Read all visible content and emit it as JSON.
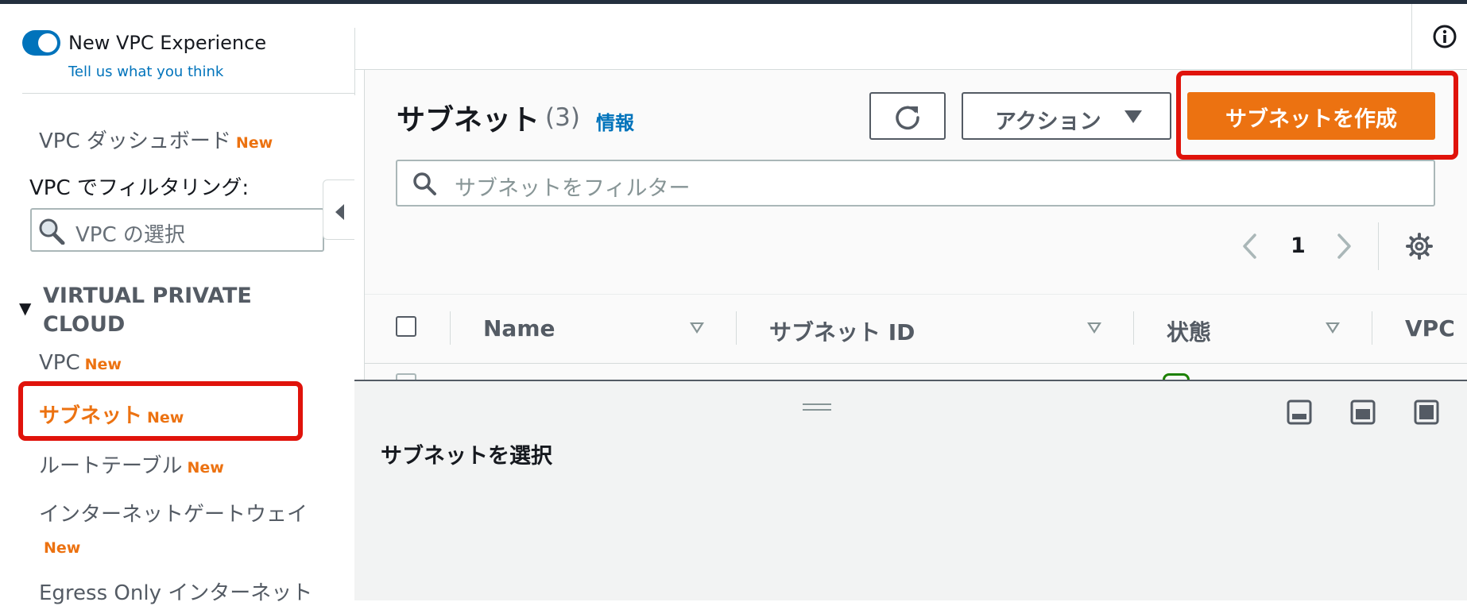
{
  "sidebar": {
    "experience_title": "New VPC Experience",
    "feedback_link": "Tell us what you think",
    "dashboard_label": "VPC ダッシュボード",
    "new_badge": "New",
    "filter_label": "VPC でフィルタリング:",
    "vpc_select_placeholder": "VPC の選択",
    "section_title": "VIRTUAL PRIVATE CLOUD",
    "items": [
      {
        "label": "VPC",
        "badge": "New"
      },
      {
        "label": "サブネット",
        "badge": "New"
      },
      {
        "label": "ルートテーブル",
        "badge": "New"
      },
      {
        "label": "インターネットゲートウェイ",
        "badge": "New"
      },
      {
        "label": "Egress Only インターネット"
      }
    ]
  },
  "main": {
    "title": "サブネット",
    "count": "(3)",
    "info_link": "情報",
    "actions_label": "アクション",
    "create_label": "サブネットを作成",
    "filter_placeholder": "サブネットをフィルター",
    "page_number": "1",
    "columns": [
      "Name",
      "サブネット ID",
      "状態",
      "VPC"
    ]
  },
  "split_panel": {
    "title": "サブネットを選択"
  },
  "colors": {
    "accent": "#ec7211",
    "link": "#0073bb",
    "highlight": "#e0130b",
    "success": "#1d8102"
  }
}
